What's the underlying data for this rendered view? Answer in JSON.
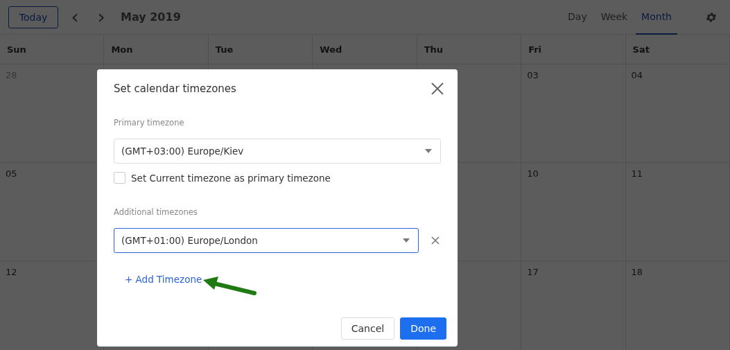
{
  "toolbar": {
    "today": "Today",
    "prev": "‹",
    "next": "›",
    "title": "May 2019",
    "views": [
      {
        "label": "Day",
        "selected": false
      },
      {
        "label": "Week",
        "selected": false
      },
      {
        "label": "Month",
        "selected": true
      }
    ]
  },
  "weekdays": [
    "Sun",
    "Mon",
    "Tue",
    "Wed",
    "Thu",
    "Fri",
    "Sat"
  ],
  "weeks": [
    {
      "start": [
        {
          "date": "28",
          "other_month": true
        }
      ],
      "end": [
        {
          "date": "03",
          "other_month": false
        },
        {
          "date": "04",
          "other_month": false
        }
      ]
    },
    {
      "start": [
        {
          "date": "05",
          "other_month": false
        }
      ],
      "end": [
        {
          "date": "10",
          "other_month": false
        },
        {
          "date": "11",
          "other_month": false
        }
      ]
    },
    {
      "start": [
        {
          "date": "12",
          "other_month": false
        }
      ],
      "end": [
        {
          "date": "17",
          "other_month": false
        },
        {
          "date": "18",
          "other_month": false
        }
      ]
    }
  ],
  "dialog": {
    "title": "Set calendar timezones",
    "primary_label": "Primary timezone",
    "primary_value": "(GMT+03:00) Europe/Kiev",
    "checkbox": {
      "label": "Set Current timezone as primary timezone",
      "checked": false
    },
    "additional_label": "Additional timezones",
    "additional": [
      {
        "value": "(GMT+01:00) Europe/London",
        "focused": true
      }
    ],
    "add_link": "+ Add Timezone",
    "buttons": [
      {
        "label": "Cancel",
        "kind": "secondary"
      },
      {
        "label": "Done",
        "kind": "primary"
      }
    ]
  }
}
